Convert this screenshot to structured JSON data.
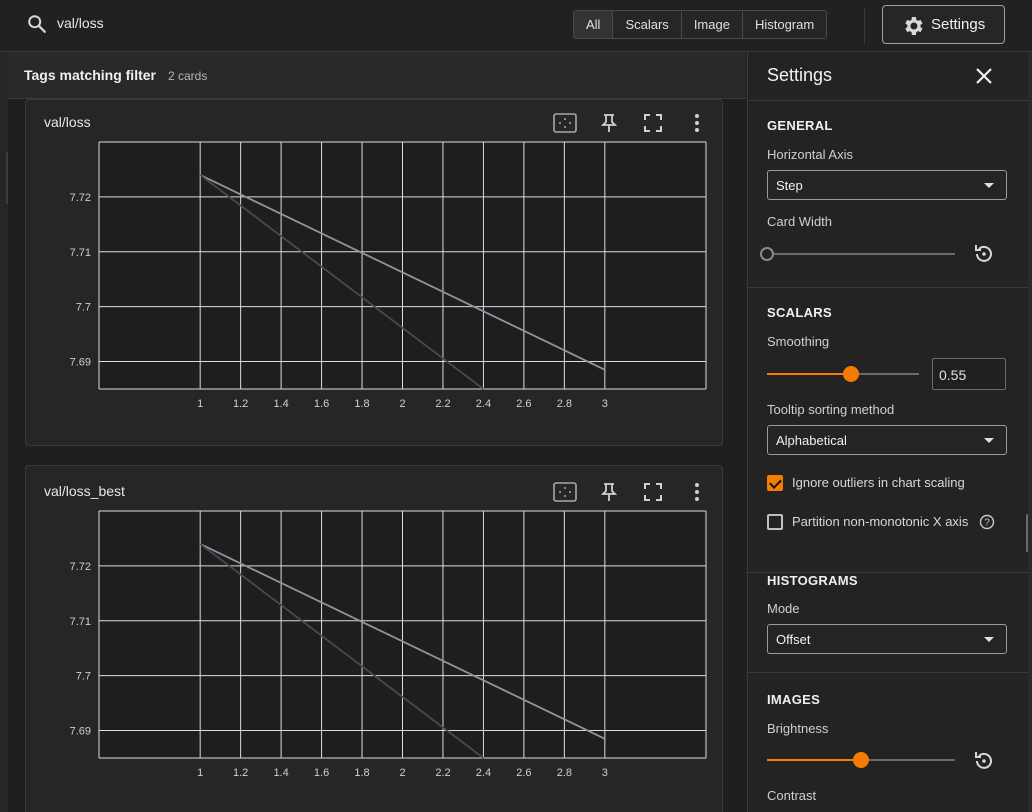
{
  "search": {
    "value": "val/loss"
  },
  "type_filter": {
    "options": [
      "All",
      "Scalars",
      "Image",
      "Histogram"
    ],
    "selected": "All"
  },
  "settings_button": {
    "label": "Settings"
  },
  "filter_header": {
    "title": "Tags matching filter",
    "count": "2 cards"
  },
  "cards": [
    {
      "title": "val/loss"
    },
    {
      "title": "val/loss_best"
    }
  ],
  "chart_data": [
    {
      "type": "line",
      "title": "val/loss",
      "xlabel": "",
      "ylabel": "",
      "xlim": [
        0.5,
        3.5
      ],
      "ylim": [
        7.685,
        7.73
      ],
      "xticks": [
        "1",
        "1.2",
        "1.4",
        "1.6",
        "1.8",
        "2",
        "2.2",
        "2.4",
        "2.6",
        "2.8",
        "3"
      ],
      "yticks": [
        "7.69",
        "7.7",
        "7.71",
        "7.72"
      ],
      "grid": true,
      "series": [
        {
          "x": [
            1,
            3
          ],
          "y": [
            7.724,
            7.6885
          ]
        },
        {
          "x": [
            1,
            2.4
          ],
          "y": [
            7.724,
            7.685
          ]
        }
      ]
    },
    {
      "type": "line",
      "title": "val/loss_best",
      "xlabel": "",
      "ylabel": "",
      "xlim": [
        0.5,
        3.5
      ],
      "ylim": [
        7.685,
        7.73
      ],
      "xticks": [
        "1",
        "1.2",
        "1.4",
        "1.6",
        "1.8",
        "2",
        "2.2",
        "2.4",
        "2.6",
        "2.8",
        "3"
      ],
      "yticks": [
        "7.69",
        "7.7",
        "7.71",
        "7.72"
      ],
      "grid": true,
      "series": [
        {
          "x": [
            1,
            3
          ],
          "y": [
            7.724,
            7.6885
          ]
        },
        {
          "x": [
            1,
            2.4
          ],
          "y": [
            7.724,
            7.685
          ]
        }
      ]
    }
  ],
  "settings": {
    "title": "Settings",
    "general": {
      "title": "GENERAL",
      "horizontal_axis_label": "Horizontal Axis",
      "horizontal_axis_value": "Step",
      "card_width_label": "Card Width",
      "card_width_level": 0
    },
    "scalars": {
      "title": "SCALARS",
      "smoothing_label": "Smoothing",
      "smoothing_value": "0.55",
      "smoothing_level": 0.55,
      "tooltip_label": "Tooltip sorting method",
      "tooltip_value": "Alphabetical",
      "ignore_outliers_label": "Ignore outliers in chart scaling",
      "ignore_outliers_checked": true,
      "partition_label": "Partition non-monotonic X axis",
      "partition_checked": false
    },
    "histograms": {
      "title": "HISTOGRAMS",
      "mode_label": "Mode",
      "mode_value": "Offset"
    },
    "images": {
      "title": "IMAGES",
      "brightness_label": "Brightness",
      "brightness_level": 0.5,
      "contrast_label": "Contrast"
    }
  },
  "colors": {
    "accent": "#f57c00",
    "series_light": "#8a96a3",
    "series_dark": "#4a4a4a"
  }
}
